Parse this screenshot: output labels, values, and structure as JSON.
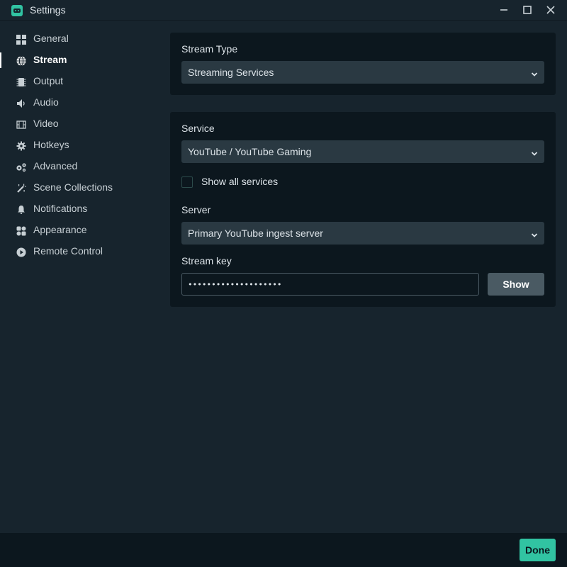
{
  "window": {
    "title": "Settings"
  },
  "sidebar": {
    "items": [
      {
        "label": "General",
        "icon": "grid-icon"
      },
      {
        "label": "Stream",
        "icon": "globe-icon",
        "active": true
      },
      {
        "label": "Output",
        "icon": "chip-icon"
      },
      {
        "label": "Audio",
        "icon": "speaker-icon"
      },
      {
        "label": "Video",
        "icon": "film-icon"
      },
      {
        "label": "Hotkeys",
        "icon": "gear-icon"
      },
      {
        "label": "Advanced",
        "icon": "gears-icon"
      },
      {
        "label": "Scene Collections",
        "icon": "magic-wand-icon"
      },
      {
        "label": "Notifications",
        "icon": "bell-icon"
      },
      {
        "label": "Appearance",
        "icon": "appearance-icon"
      },
      {
        "label": "Remote Control",
        "icon": "play-circle-icon"
      }
    ]
  },
  "stream_type": {
    "label": "Stream Type",
    "value": "Streaming Services"
  },
  "service": {
    "label": "Service",
    "value": "YouTube / YouTube Gaming",
    "show_all_label": "Show all services",
    "show_all_checked": false
  },
  "server": {
    "label": "Server",
    "value": "Primary YouTube ingest server"
  },
  "stream_key": {
    "label": "Stream key",
    "value": "••••••••••••••••••••",
    "show_label": "Show"
  },
  "footer": {
    "done_label": "Done"
  },
  "colors": {
    "background": "#17242d",
    "panel": "#0c171e",
    "select": "#2a3942",
    "accent": "#31c3a2",
    "button": "#4a5a63"
  }
}
